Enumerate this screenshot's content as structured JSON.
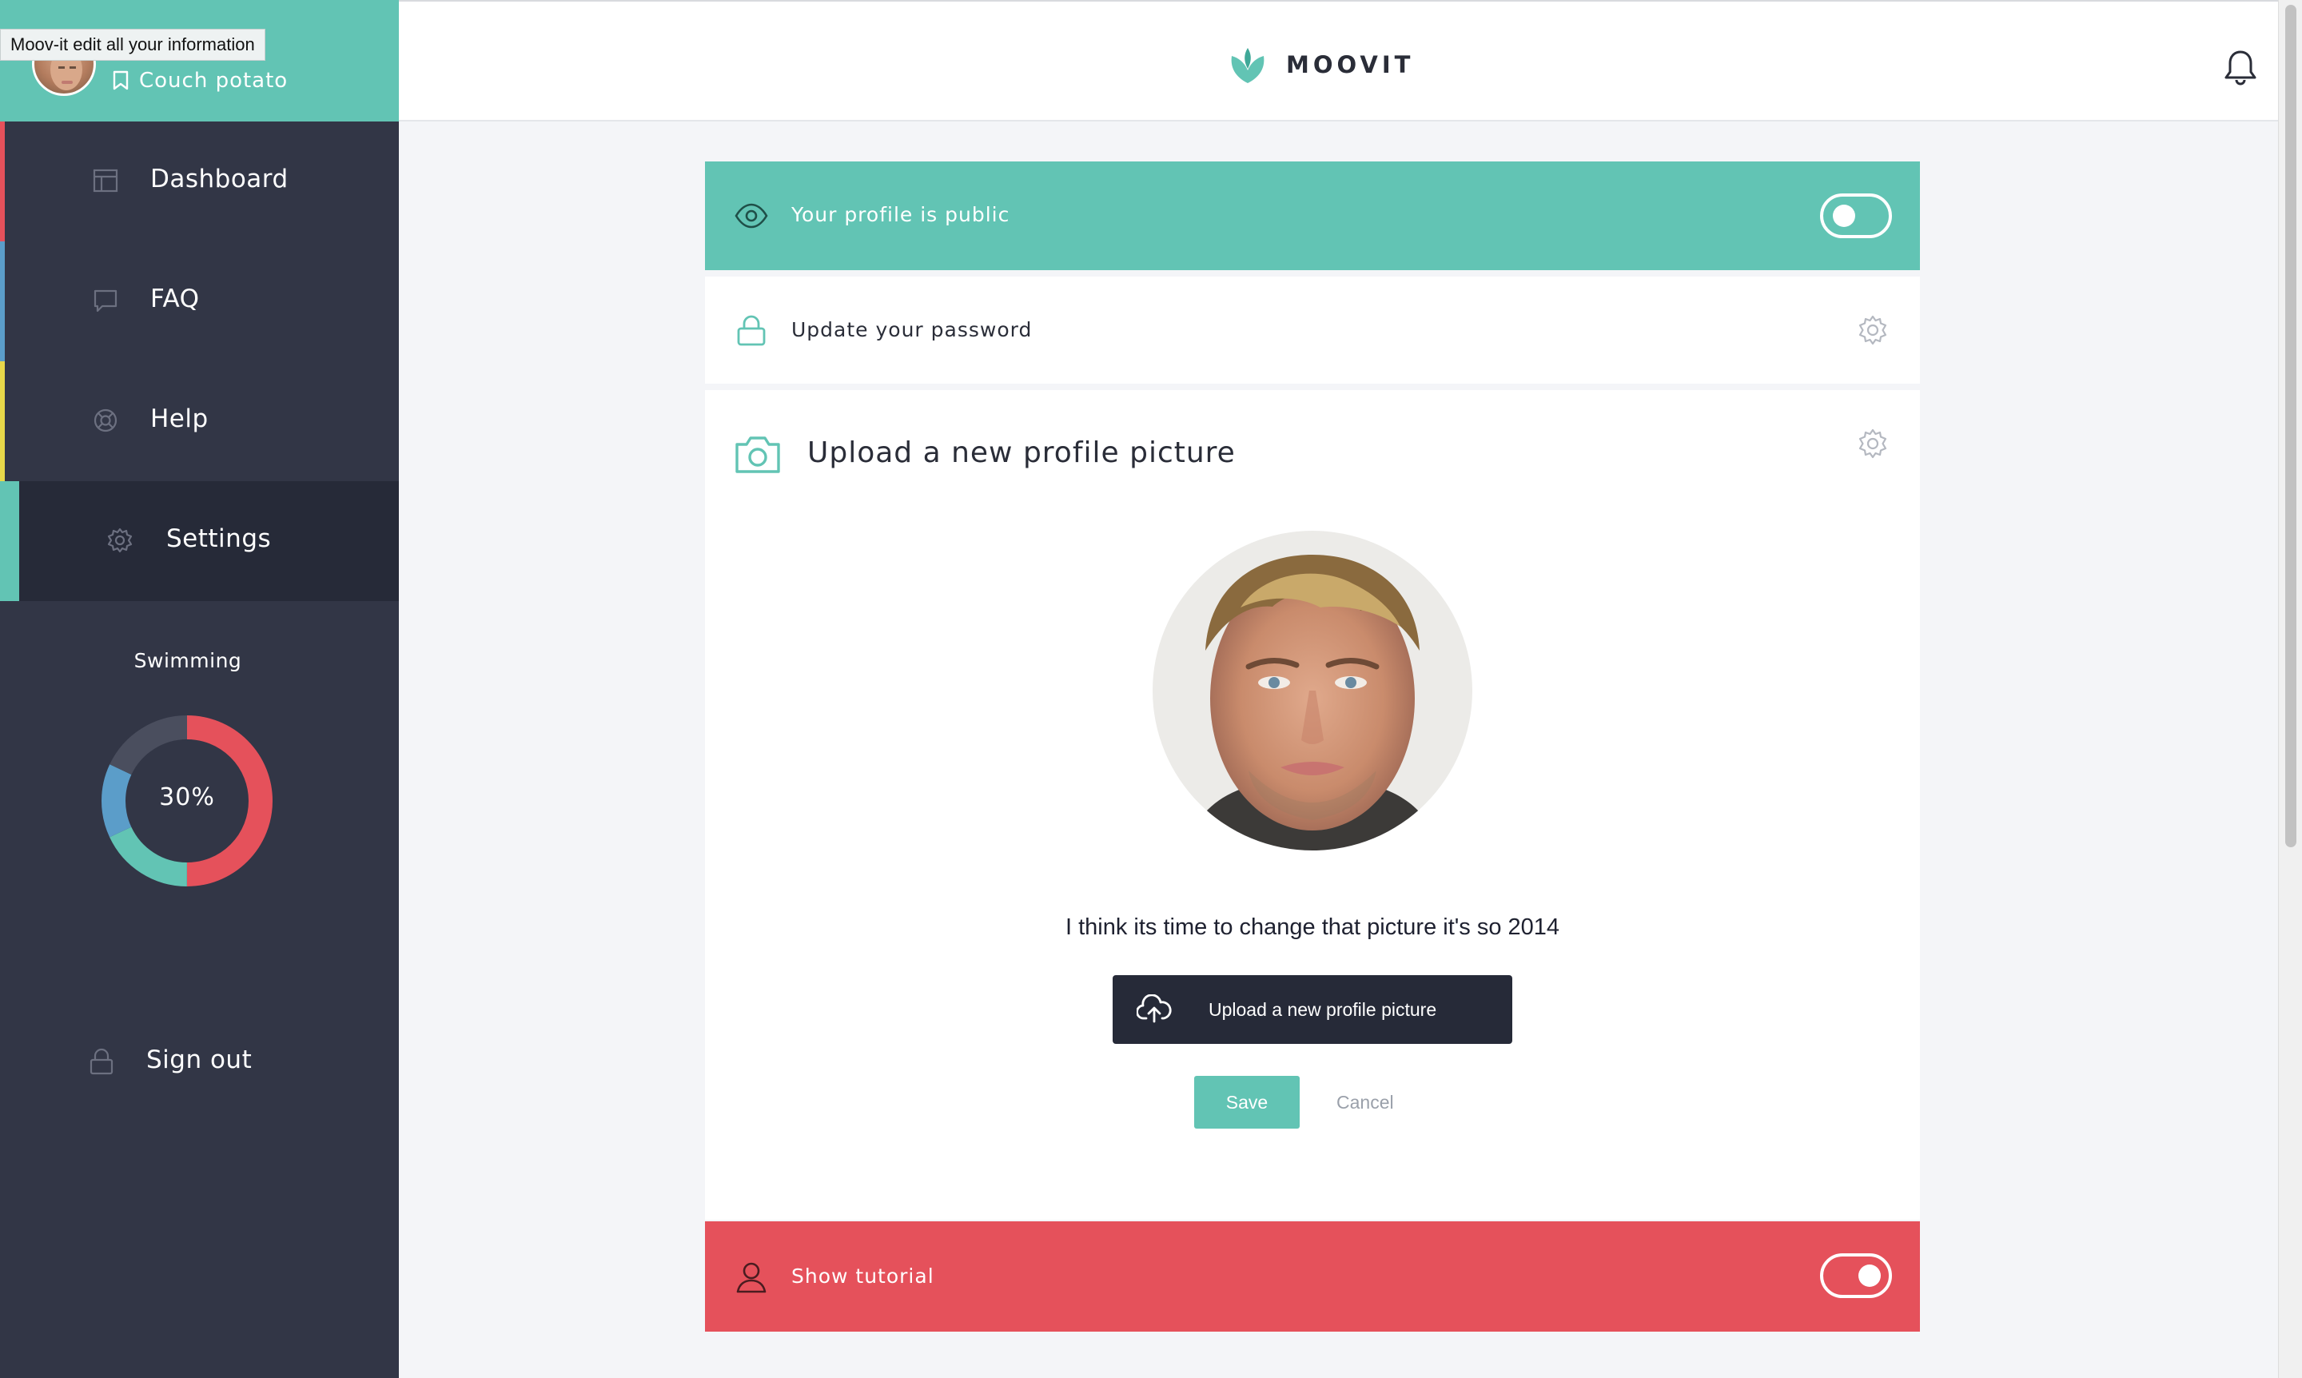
{
  "tooltip": "Moov-it edit all your information",
  "user": {
    "status": "Couch potato"
  },
  "nav": {
    "items": [
      {
        "label": "Dashboard",
        "accent": "#e5515b"
      },
      {
        "label": "FAQ",
        "accent": "#5b9dc9"
      },
      {
        "label": "Help",
        "accent": "#e8d84a"
      },
      {
        "label": "Settings",
        "accent": "#62c4b4",
        "active": true
      }
    ],
    "signout": "Sign out"
  },
  "activity": {
    "label": "Swimming",
    "percent_label": "30%",
    "segments": [
      {
        "name": "red",
        "fraction": 0.5,
        "color": "#e5515b"
      },
      {
        "name": "teal",
        "fraction": 0.18,
        "color": "#62c4b4"
      },
      {
        "name": "blue",
        "fraction": 0.14,
        "color": "#5b9dc9"
      },
      {
        "name": "gray",
        "fraction": 0.18,
        "color": "#4a4e5e"
      }
    ]
  },
  "header": {
    "brand": "MOOVIT"
  },
  "settings": {
    "public": {
      "label": "Your profile is public",
      "toggle_on": false
    },
    "password": {
      "label": "Update your password"
    },
    "picture": {
      "title": "Upload a new profile picture",
      "caption": "I think its time to change that picture it's so 2014",
      "upload_label": "Upload a new profile picture",
      "save_label": "Save",
      "cancel_label": "Cancel"
    },
    "tutorial": {
      "label": "Show tutorial",
      "toggle_on": true
    }
  },
  "colors": {
    "teal": "#62c4b4",
    "red": "#e5515b",
    "sidebar": "#323646",
    "dark": "#262a38"
  }
}
